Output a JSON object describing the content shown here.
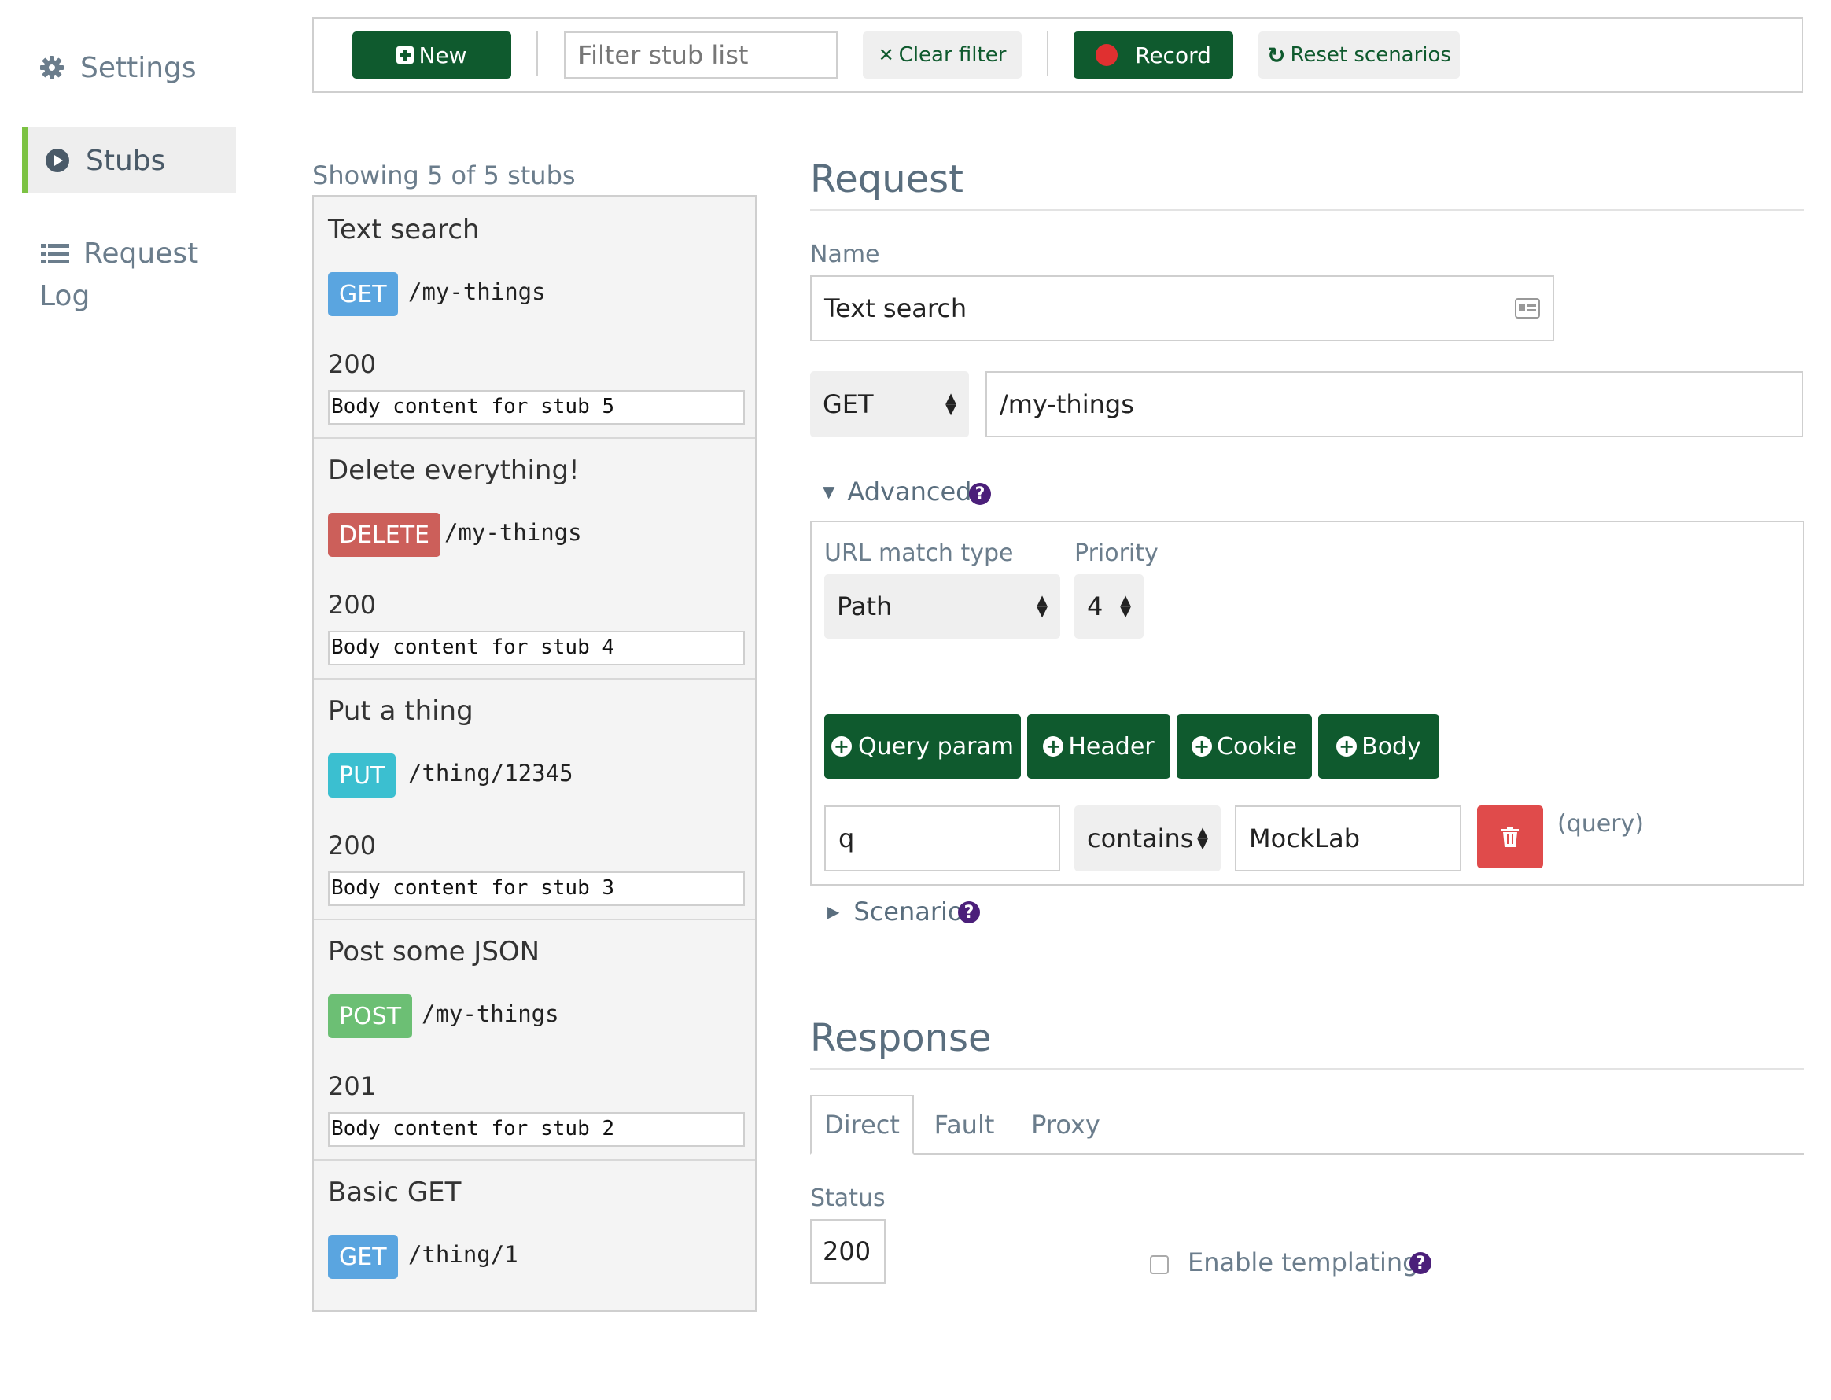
{
  "sidebar": {
    "items": [
      {
        "label": "Settings",
        "icon": "gear-icon"
      },
      {
        "label": "Stubs",
        "icon": "play-circle-icon",
        "active": true
      },
      {
        "label": "Request Log",
        "icon": "list-icon"
      }
    ]
  },
  "toolbar": {
    "new_label": "New",
    "filter_placeholder": "Filter stub list",
    "clear_filter_label": "Clear filter",
    "record_label": "Record",
    "reset_scenarios_label": "Reset scenarios"
  },
  "stub_list": {
    "showing_text": "Showing 5 of 5 stubs",
    "stubs": [
      {
        "name": "Text search",
        "method": "GET",
        "method_color": "#5aa5e0",
        "url": "/my-things",
        "status": "200",
        "body": "Body content for stub 5"
      },
      {
        "name": "Delete everything!",
        "method": "DELETE",
        "method_color": "#cc5f5a",
        "url": "/my-things",
        "status": "200",
        "body": "Body content for stub 4"
      },
      {
        "name": "Put a thing",
        "method": "PUT",
        "method_color": "#3bbfd0",
        "url": "/thing/12345",
        "status": "200",
        "body": "Body content for stub 3"
      },
      {
        "name": "Post some JSON",
        "method": "POST",
        "method_color": "#6cbf74",
        "url": "/my-things",
        "status": "201",
        "body": "Body content for stub 2"
      },
      {
        "name": "Basic GET",
        "method": "GET",
        "method_color": "#5aa5e0",
        "url": "/thing/1",
        "status": "",
        "body": ""
      }
    ]
  },
  "request": {
    "title": "Request",
    "name_label": "Name",
    "name_value": "Text search",
    "method_value": "GET",
    "url_value": "/my-things",
    "advanced_label": "Advanced",
    "url_match_type_label": "URL match type",
    "url_match_type_value": "Path",
    "priority_label": "Priority",
    "priority_value": "4",
    "add_buttons": [
      "Query param",
      "Header",
      "Cookie",
      "Body"
    ],
    "matcher": {
      "key": "q",
      "operator": "contains",
      "value": "MockLab",
      "kind": "(query)"
    },
    "scenario_label": "Scenario"
  },
  "response": {
    "title": "Response",
    "tabs": [
      "Direct",
      "Fault",
      "Proxy"
    ],
    "active_tab": "Direct",
    "status_label": "Status",
    "status_value": "200",
    "templating_label": "Enable templating"
  },
  "colors": {
    "accent_green": "#0f5a2e",
    "active_bar": "#7cc243",
    "record_dot": "#e03030",
    "delete_red": "#e04b4b",
    "help_purple": "#4b1f7a"
  }
}
